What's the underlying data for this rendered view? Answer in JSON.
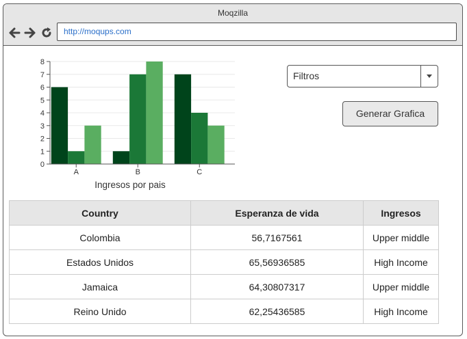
{
  "window": {
    "title": "Moqzilla",
    "url": "http://moqups.com"
  },
  "icons": {
    "back": "arrow-left-icon",
    "forward": "arrow-right-icon",
    "reload": "reload-icon"
  },
  "filters": {
    "label": "Filtros"
  },
  "generate_button": {
    "label": "Generar Grafica"
  },
  "chart_data": {
    "type": "bar",
    "categories": [
      "A",
      "B",
      "C"
    ],
    "series": [
      {
        "values": [
          6,
          1,
          7
        ],
        "color": "#00441b"
      },
      {
        "values": [
          1,
          7,
          4
        ],
        "color": "#1b7837"
      },
      {
        "values": [
          3,
          8,
          3
        ],
        "color": "#5aae61"
      }
    ],
    "xlabel": "Ingresos por pais",
    "ylim": [
      0,
      8
    ],
    "yticks": [
      0,
      1,
      2,
      3,
      4,
      5,
      6,
      7,
      8
    ],
    "grid": true
  },
  "table": {
    "headers": [
      "Country",
      "Esperanza de vida",
      "Ingresos"
    ],
    "rows": [
      [
        "Colombia",
        "56,7167561",
        "Upper middle"
      ],
      [
        "Estados Unidos",
        "65,56936585",
        "High Income"
      ],
      [
        "Jamaica",
        "64,30807317",
        "Upper middle"
      ],
      [
        "Reino Unido",
        "62,25436585",
        "High Income"
      ]
    ]
  }
}
